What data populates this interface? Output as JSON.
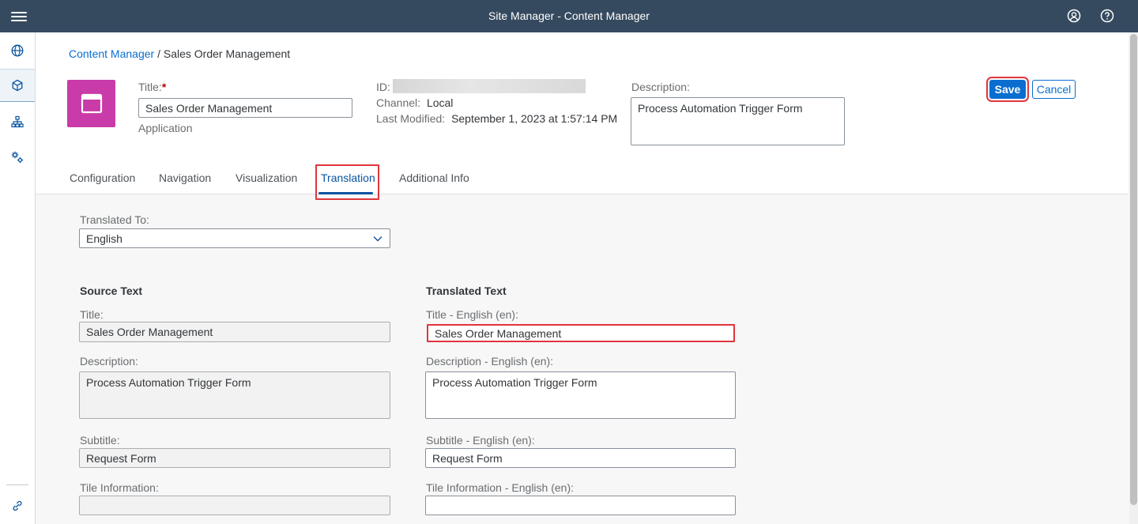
{
  "shell": {
    "title": "Site Manager - Content Manager"
  },
  "breadcrumb": {
    "link": "Content Manager",
    "separator": "/",
    "current": "Sales Order Management"
  },
  "header": {
    "title_label": "Title:",
    "title_required": "*",
    "title_value": "Sales Order Management",
    "type": "Application",
    "id_label": "ID:",
    "channel_label": "Channel:",
    "channel_value": "Local",
    "modified_label": "Last Modified:",
    "modified_value": "September 1, 2023 at 1:57:14 PM",
    "description_label": "Description:",
    "description_value": "Process Automation Trigger Form",
    "save_label": "Save",
    "cancel_label": "Cancel",
    "tile_color": "#c93ba8"
  },
  "tabs": [
    {
      "label": "Configuration"
    },
    {
      "label": "Navigation"
    },
    {
      "label": "Visualization"
    },
    {
      "label": "Translation",
      "active": true
    },
    {
      "label": "Additional Info"
    }
  ],
  "translation": {
    "translated_to_label": "Translated To:",
    "language_value": "English",
    "source": {
      "heading": "Source Text",
      "title_label": "Title:",
      "title_value": "Sales Order Management",
      "description_label": "Description:",
      "description_value": "Process Automation Trigger Form",
      "subtitle_label": "Subtitle:",
      "subtitle_value": "Request Form",
      "tile_info_label": "Tile Information:",
      "tile_info_value": ""
    },
    "target": {
      "heading": "Translated Text",
      "title_label": "Title - English (en):",
      "title_value": "Sales Order Management",
      "description_label": "Description - English (en):",
      "description_value": "Process Automation Trigger Form",
      "subtitle_label": "Subtitle - English (en):",
      "subtitle_value": "Request Form",
      "tile_info_label": "Tile Information - English (en):",
      "tile_info_value": ""
    }
  },
  "colors": {
    "shell": "#354a5f",
    "accent": "#0a6ed1",
    "highlight": "#e0353d"
  }
}
